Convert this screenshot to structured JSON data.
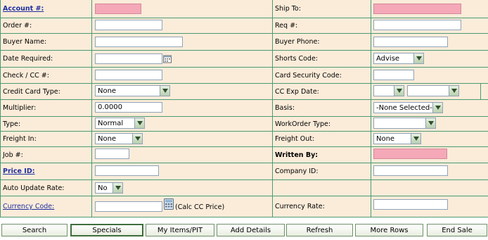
{
  "form": {
    "account": {
      "label": "Account #:",
      "value": ""
    },
    "ship_to": {
      "label": "Ship To:",
      "value": ""
    },
    "order": {
      "label": "Order #:",
      "value": ""
    },
    "req": {
      "label": "Req #:",
      "value": ""
    },
    "buyer_name": {
      "label": "Buyer Name:",
      "value": ""
    },
    "buyer_phone": {
      "label": "Buyer Phone:",
      "value": ""
    },
    "date_required": {
      "label": "Date Required:",
      "value": ""
    },
    "shorts_code": {
      "label": "Shorts Code:",
      "value": "Advise"
    },
    "check_cc": {
      "label": "Check / CC #:",
      "value": ""
    },
    "card_security": {
      "label": "Card Security Code:",
      "value": ""
    },
    "cc_type": {
      "label": "Credit Card Type:",
      "value": "None"
    },
    "cc_exp": {
      "label": "CC Exp Date:",
      "month": "",
      "year": ""
    },
    "multiplier": {
      "label": "Multiplier:",
      "value": "0.0000"
    },
    "basis": {
      "label": "Basis:",
      "value": "-None Selected-"
    },
    "type": {
      "label": "Type:",
      "value": "Normal"
    },
    "workorder_type": {
      "label": "WorkOrder Type:",
      "value": ""
    },
    "freight_in": {
      "label": "Freight In:",
      "value": "None"
    },
    "freight_out": {
      "label": "Freight Out:",
      "value": "None"
    },
    "job": {
      "label": "Job #:",
      "value": ""
    },
    "written_by": {
      "label": "Written By:",
      "value": ""
    },
    "price_id": {
      "label": "Price ID:",
      "value": ""
    },
    "company_id": {
      "label": "Company ID:",
      "value": ""
    },
    "auto_update_rate": {
      "label": "Auto Update Rate:",
      "value": "No"
    },
    "currency_code": {
      "label": "Currency Code:",
      "value": "",
      "calc_label": "(Calc CC Price)"
    },
    "currency_rate": {
      "label": "Currency Rate:",
      "value": ""
    }
  },
  "buttons": {
    "search": "Search",
    "specials": "Specials",
    "my_items": "My Items/PIT",
    "add_details": "Add Details",
    "refresh": "Refresh",
    "more_rows": "More Rows",
    "end_sale": "End Sale"
  },
  "colors": {
    "background": "#fbecd9",
    "grid_lines": "#4c9a73",
    "required_field": "#f4a8b8",
    "link": "#1f2ea0"
  }
}
